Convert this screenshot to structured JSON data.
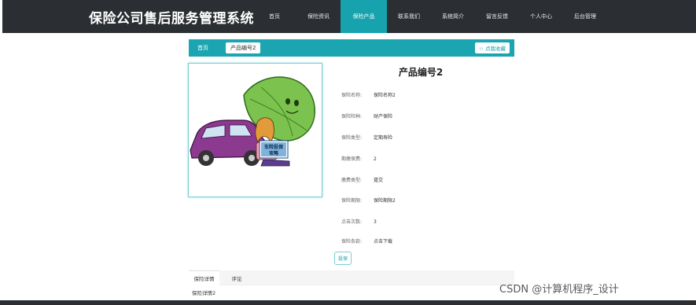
{
  "header": {
    "site_title": "保险公司售后服务管理系统",
    "nav": [
      {
        "label": "首页",
        "active": false
      },
      {
        "label": "保险资讯",
        "active": false
      },
      {
        "label": "保险产品",
        "active": true
      },
      {
        "label": "联系我们",
        "active": false
      },
      {
        "label": "系统简介",
        "active": false
      },
      {
        "label": "留言反馈",
        "active": false
      },
      {
        "label": "个人中心",
        "active": false
      },
      {
        "label": "后台管理",
        "active": false
      }
    ]
  },
  "breadcrumb": {
    "home": "首页",
    "current": "产品编号2",
    "favorite_label": "☆ 点我收藏"
  },
  "product": {
    "title": "产品编号2",
    "fields": [
      {
        "label": "保险名称:",
        "value": "保险名称2"
      },
      {
        "label": "保险险种:",
        "value": "财产保险"
      },
      {
        "label": "保险类型:",
        "value": "定期寿险"
      },
      {
        "label": "期缴保费:",
        "value": "2"
      },
      {
        "label": "缴费类型:",
        "value": "趸交"
      },
      {
        "label": "保险期限:",
        "value": "保险期限2"
      },
      {
        "label": "点击次数:",
        "value": "3"
      },
      {
        "label": "保险条款:",
        "value": "点击下载"
      }
    ],
    "buy_label": "投保",
    "image_caption": "车险投保攻略"
  },
  "tabs": [
    {
      "label": "保险详情",
      "active": true
    },
    {
      "label": "评论",
      "active": false
    }
  ],
  "tab_content": "保险详情2",
  "watermark": "CSDN @计算机程序_设计",
  "colors": {
    "accent": "#16a3ae",
    "nav_bg": "#2b2f33"
  }
}
